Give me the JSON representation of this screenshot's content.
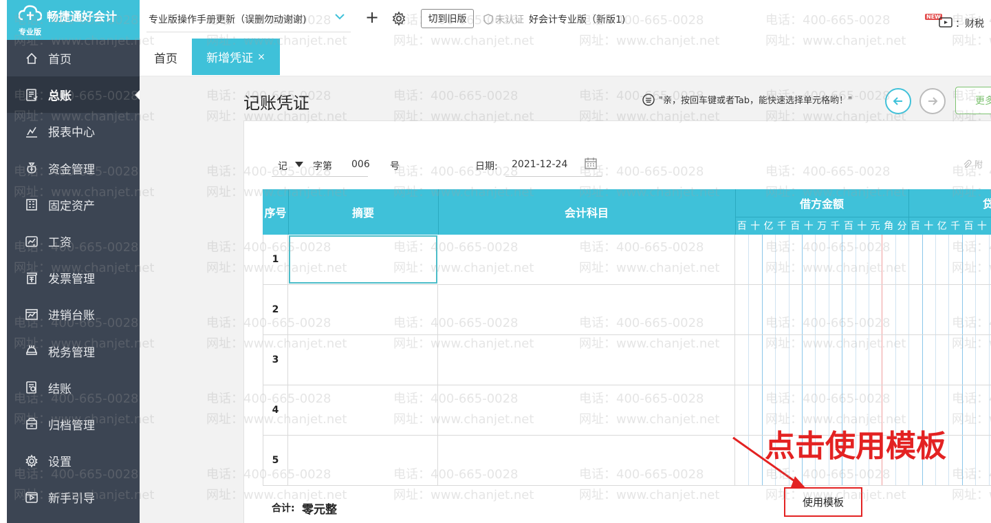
{
  "app": {
    "brand": "畅捷通好会计",
    "edition": "专业版"
  },
  "sidebar": {
    "items": [
      {
        "label": "首页",
        "icon": "home-icon"
      },
      {
        "label": "总账",
        "icon": "ledger-icon",
        "active": true
      },
      {
        "label": "报表中心",
        "icon": "chart-icon"
      },
      {
        "label": "资金管理",
        "icon": "money-bag-icon"
      },
      {
        "label": "固定资产",
        "icon": "building-icon"
      },
      {
        "label": "工资",
        "icon": "salary-icon"
      },
      {
        "label": "发票管理",
        "icon": "invoice-icon"
      },
      {
        "label": "进销台账",
        "icon": "inventory-icon"
      },
      {
        "label": "税务管理",
        "icon": "tax-icon"
      },
      {
        "label": "结账",
        "icon": "checkout-icon"
      },
      {
        "label": "归档管理",
        "icon": "archive-icon"
      },
      {
        "label": "设置",
        "icon": "gear-icon"
      },
      {
        "label": "新手引导",
        "icon": "guide-icon"
      }
    ]
  },
  "topbar": {
    "notice": "专业版操作手册更新（误删勿动谢谢)",
    "switch_label": "切到旧版",
    "cert_label": "未认证",
    "company": "好会计专业版（新版1)",
    "new_badge": "NEW",
    "tax_label": "：财税"
  },
  "tabs": {
    "home": "首页",
    "active": "新增凭证",
    "close": "×"
  },
  "voucher": {
    "title": "记账凭证",
    "hint": "\"亲，按回车键或者Tab，能快速选择单元格哟！\"",
    "more_label": "更多",
    "type": "记",
    "zi_label": "字第",
    "number": "006",
    "hao_label": "号",
    "date_label": "日期:",
    "date": "2021-12-24",
    "attach_label": "附",
    "columns": {
      "seq": "序号",
      "summary": "摘要",
      "account": "会计科目",
      "debit": "借方金额",
      "credit": "贷"
    },
    "digits": [
      "百",
      "十",
      "亿",
      "千",
      "百",
      "十",
      "万",
      "千",
      "百",
      "十",
      "元",
      "角",
      "分",
      "百",
      "十",
      "亿",
      "千",
      "百",
      "十"
    ],
    "rows": [
      "1",
      "2",
      "3",
      "4",
      "5"
    ],
    "total_label": "合计:",
    "total_value": "零元整",
    "template_button": "使用模板"
  },
  "annotation": {
    "text": "点击使用模板"
  },
  "watermark": {
    "phone": "电话：400-665-0028",
    "site": "网址：www.chanjet.net"
  },
  "colors": {
    "accent": "#3fc1d9",
    "sidebar_bg": "#3c4553",
    "annotation": "#e32222"
  }
}
